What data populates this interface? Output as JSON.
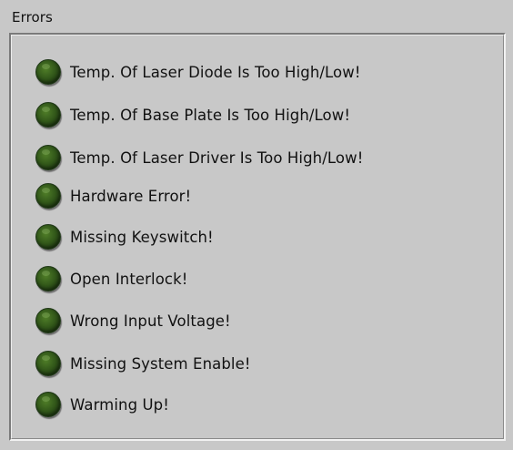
{
  "panel": {
    "title": "Errors"
  },
  "colors": {
    "background": "#c8c8c8",
    "led_off": "#2f5418"
  },
  "indicators": [
    {
      "label": "Temp. Of Laser Diode Is Too High/Low!",
      "icon": "led-indicator-icon",
      "state": "off"
    },
    {
      "label": "Temp. Of Base Plate Is Too High/Low!",
      "icon": "led-indicator-icon",
      "state": "off"
    },
    {
      "label": "Temp. Of Laser Driver Is Too High/Low!",
      "icon": "led-indicator-icon",
      "state": "off"
    },
    {
      "label": "Hardware Error!",
      "icon": "led-indicator-icon",
      "state": "off"
    },
    {
      "label": "Missing Keyswitch!",
      "icon": "led-indicator-icon",
      "state": "off"
    },
    {
      "label": "Open Interlock!",
      "icon": "led-indicator-icon",
      "state": "off"
    },
    {
      "label": "Wrong Input Voltage!",
      "icon": "led-indicator-icon",
      "state": "off"
    },
    {
      "label": "Missing System Enable!",
      "icon": "led-indicator-icon",
      "state": "off"
    },
    {
      "label": "Warming Up!",
      "icon": "led-indicator-icon",
      "state": "off"
    }
  ]
}
